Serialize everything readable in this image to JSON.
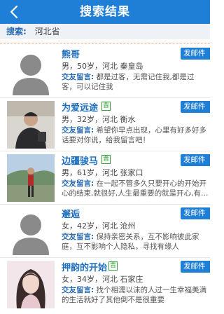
{
  "header": {
    "title": "搜索结果"
  },
  "search": {
    "label": "搜索:",
    "value": "河北省"
  },
  "results": [
    {
      "name": "熊哥",
      "verified": false,
      "gender": "男",
      "age": "50岁",
      "location": "河北 秦皇岛",
      "msg_label": "交友留言:",
      "msg": "都是过客，无需记住我,都是过客，可以记住我",
      "mail": "发邮件"
    },
    {
      "name": "为爱远途",
      "verified": true,
      "badge": "晋",
      "gender": "男",
      "age": "32岁",
      "location": "河北 衡水",
      "msg_label": "交友留言:",
      "msg": "希望你早点出现，心里有好多好多话要对你说，给我留言吧！",
      "mail": "发邮件"
    },
    {
      "name": "边疆骏马",
      "verified": true,
      "badge": "晋",
      "gender": "男",
      "age": "61岁",
      "location": "河北 张家口",
      "msg_label": "交友留言:",
      "msg": "在一起不管多久只要开心的开始开心的结束,就很好,人生最重要的就是开心,有…",
      "mail": "发邮件"
    },
    {
      "name": "邂逅",
      "verified": false,
      "gender": "女",
      "age": "42岁",
      "location": "河北 沧州",
      "msg_label": "交友留言:",
      "msg": "保持亲密关系，互不影响彼此家庭，互不影响个人隐私，寻找有缘人",
      "mail": "发邮件"
    },
    {
      "name": "押韵的开始",
      "verified": true,
      "badge": "晋",
      "gender": "女",
      "age": "34岁",
      "location": "河北 石家庄",
      "msg_label": "交友留言:",
      "msg": "找个相濡以沫的人过一生幸福美满的生活就好了其他倒不是很重要",
      "mail": "发邮件"
    }
  ],
  "icons": {
    "back": "back-chevron-icon",
    "avatar_default": "default-avatar-icon"
  },
  "colors": {
    "header_bg": "#1f7fd6",
    "name": "#1f6fbf",
    "badge": "#36a23c",
    "divider": "#f0a080"
  }
}
